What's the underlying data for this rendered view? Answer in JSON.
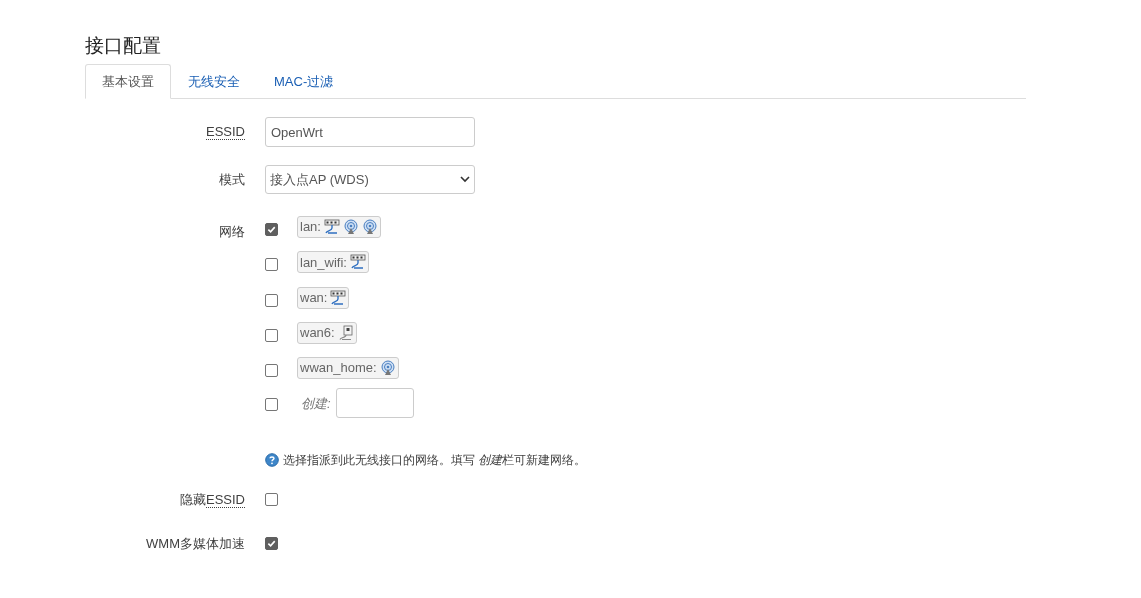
{
  "title": "接口配置",
  "tabs": [
    {
      "label": "基本设置",
      "selected": true
    },
    {
      "label": "无线安全",
      "selected": false
    },
    {
      "label": "MAC-过滤",
      "selected": false
    }
  ],
  "essid": {
    "label": [
      {
        "text": "ESSID",
        "dotted": true
      }
    ],
    "value": "OpenWrt"
  },
  "mode": {
    "label": [
      {
        "text": "模式",
        "dotted": false
      }
    ],
    "value": "接入点AP (WDS)"
  },
  "network": {
    "label": [
      {
        "text": "网络",
        "dotted": false
      }
    ],
    "items": [
      {
        "name": "lan:",
        "checked": true,
        "icons": [
          {
            "kind": "ethernet"
          },
          {
            "kind": "wireless"
          },
          {
            "kind": "wireless"
          }
        ]
      },
      {
        "name": "lan_wifi:",
        "checked": false,
        "icons": [
          {
            "kind": "ethernet"
          }
        ]
      },
      {
        "name": "wan:",
        "checked": false,
        "icons": [
          {
            "kind": "ethernet"
          }
        ]
      },
      {
        "name": "wan6:",
        "checked": false,
        "icons": [
          {
            "kind": "port"
          }
        ]
      },
      {
        "name": "wwan_home:",
        "checked": false,
        "icons": [
          {
            "kind": "wireless"
          }
        ]
      }
    ],
    "create": {
      "label": "创建:",
      "checked": false
    },
    "help": [
      {
        "text": "选择指派到此无线接口的网络。填写 ",
        "italic": false
      },
      {
        "text": "创建",
        "italic": true
      },
      {
        "text": "栏可新建网络。",
        "italic": false
      }
    ]
  },
  "hidden_essid": {
    "label": [
      {
        "text": "隐藏",
        "dotted": false
      },
      {
        "text": "ESSID",
        "dotted": true
      }
    ],
    "checked": false
  },
  "wmm": {
    "label": [
      {
        "text": "WMM多媒体加速",
        "dotted": false
      }
    ],
    "checked": true
  }
}
